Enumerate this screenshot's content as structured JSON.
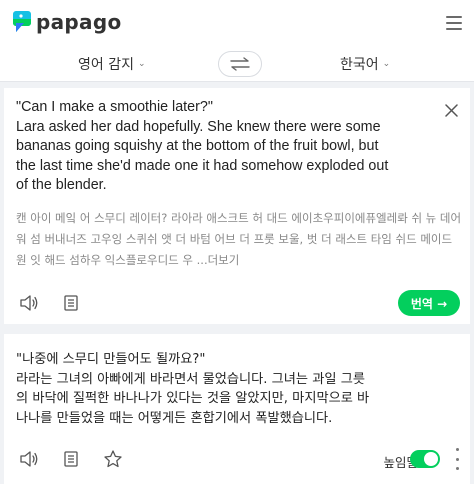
{
  "header": {
    "logo_text": "papago",
    "brand_colors": {
      "teal": "#16c0e4",
      "green": "#03cf5d",
      "blue": "#2d7af6"
    }
  },
  "langbar": {
    "source_lang": "영어 감지",
    "target_lang": "한국어"
  },
  "source": {
    "text": "\"Can I make a smoothie later?\"\nLara asked her dad hopefully. She knew there were some\nbananas going squishy at the bottom of the fruit bowl, but\nthe last time she'd made one it had somehow exploded out\nof the blender.",
    "pronunciation": "캔 아이 메잌 어 스무디 레이터? 라아라 애스크트 허 대드 에이초우피이에퓨엘레롸 쉬 뉴 데어 워 섬 버내너즈 고우잉 스퀴쉬 앳 더 바텀 어브 더 프룻 보울, 벗 더 래스트 타임 쉬드 메이드 원 잇 해드 섬하우 익스플로우디드 우",
    "more_label": "...더보기",
    "translate_label": "번역 →"
  },
  "target": {
    "text": "\"나중에 스무디 만들어도 될까요?\"\n라라는 그녀의 아빠에게 바라면서 물었습니다. 그녀는 과일 그릇\n의 바닥에 질퍽한 바나나가 있다는 것을 알았지만, 마지막으로 바\n나나를 만들었을 때는 어떻게든 혼합기에서 폭발했습니다.",
    "honorific_label": "높임말",
    "honorific_on": true
  }
}
